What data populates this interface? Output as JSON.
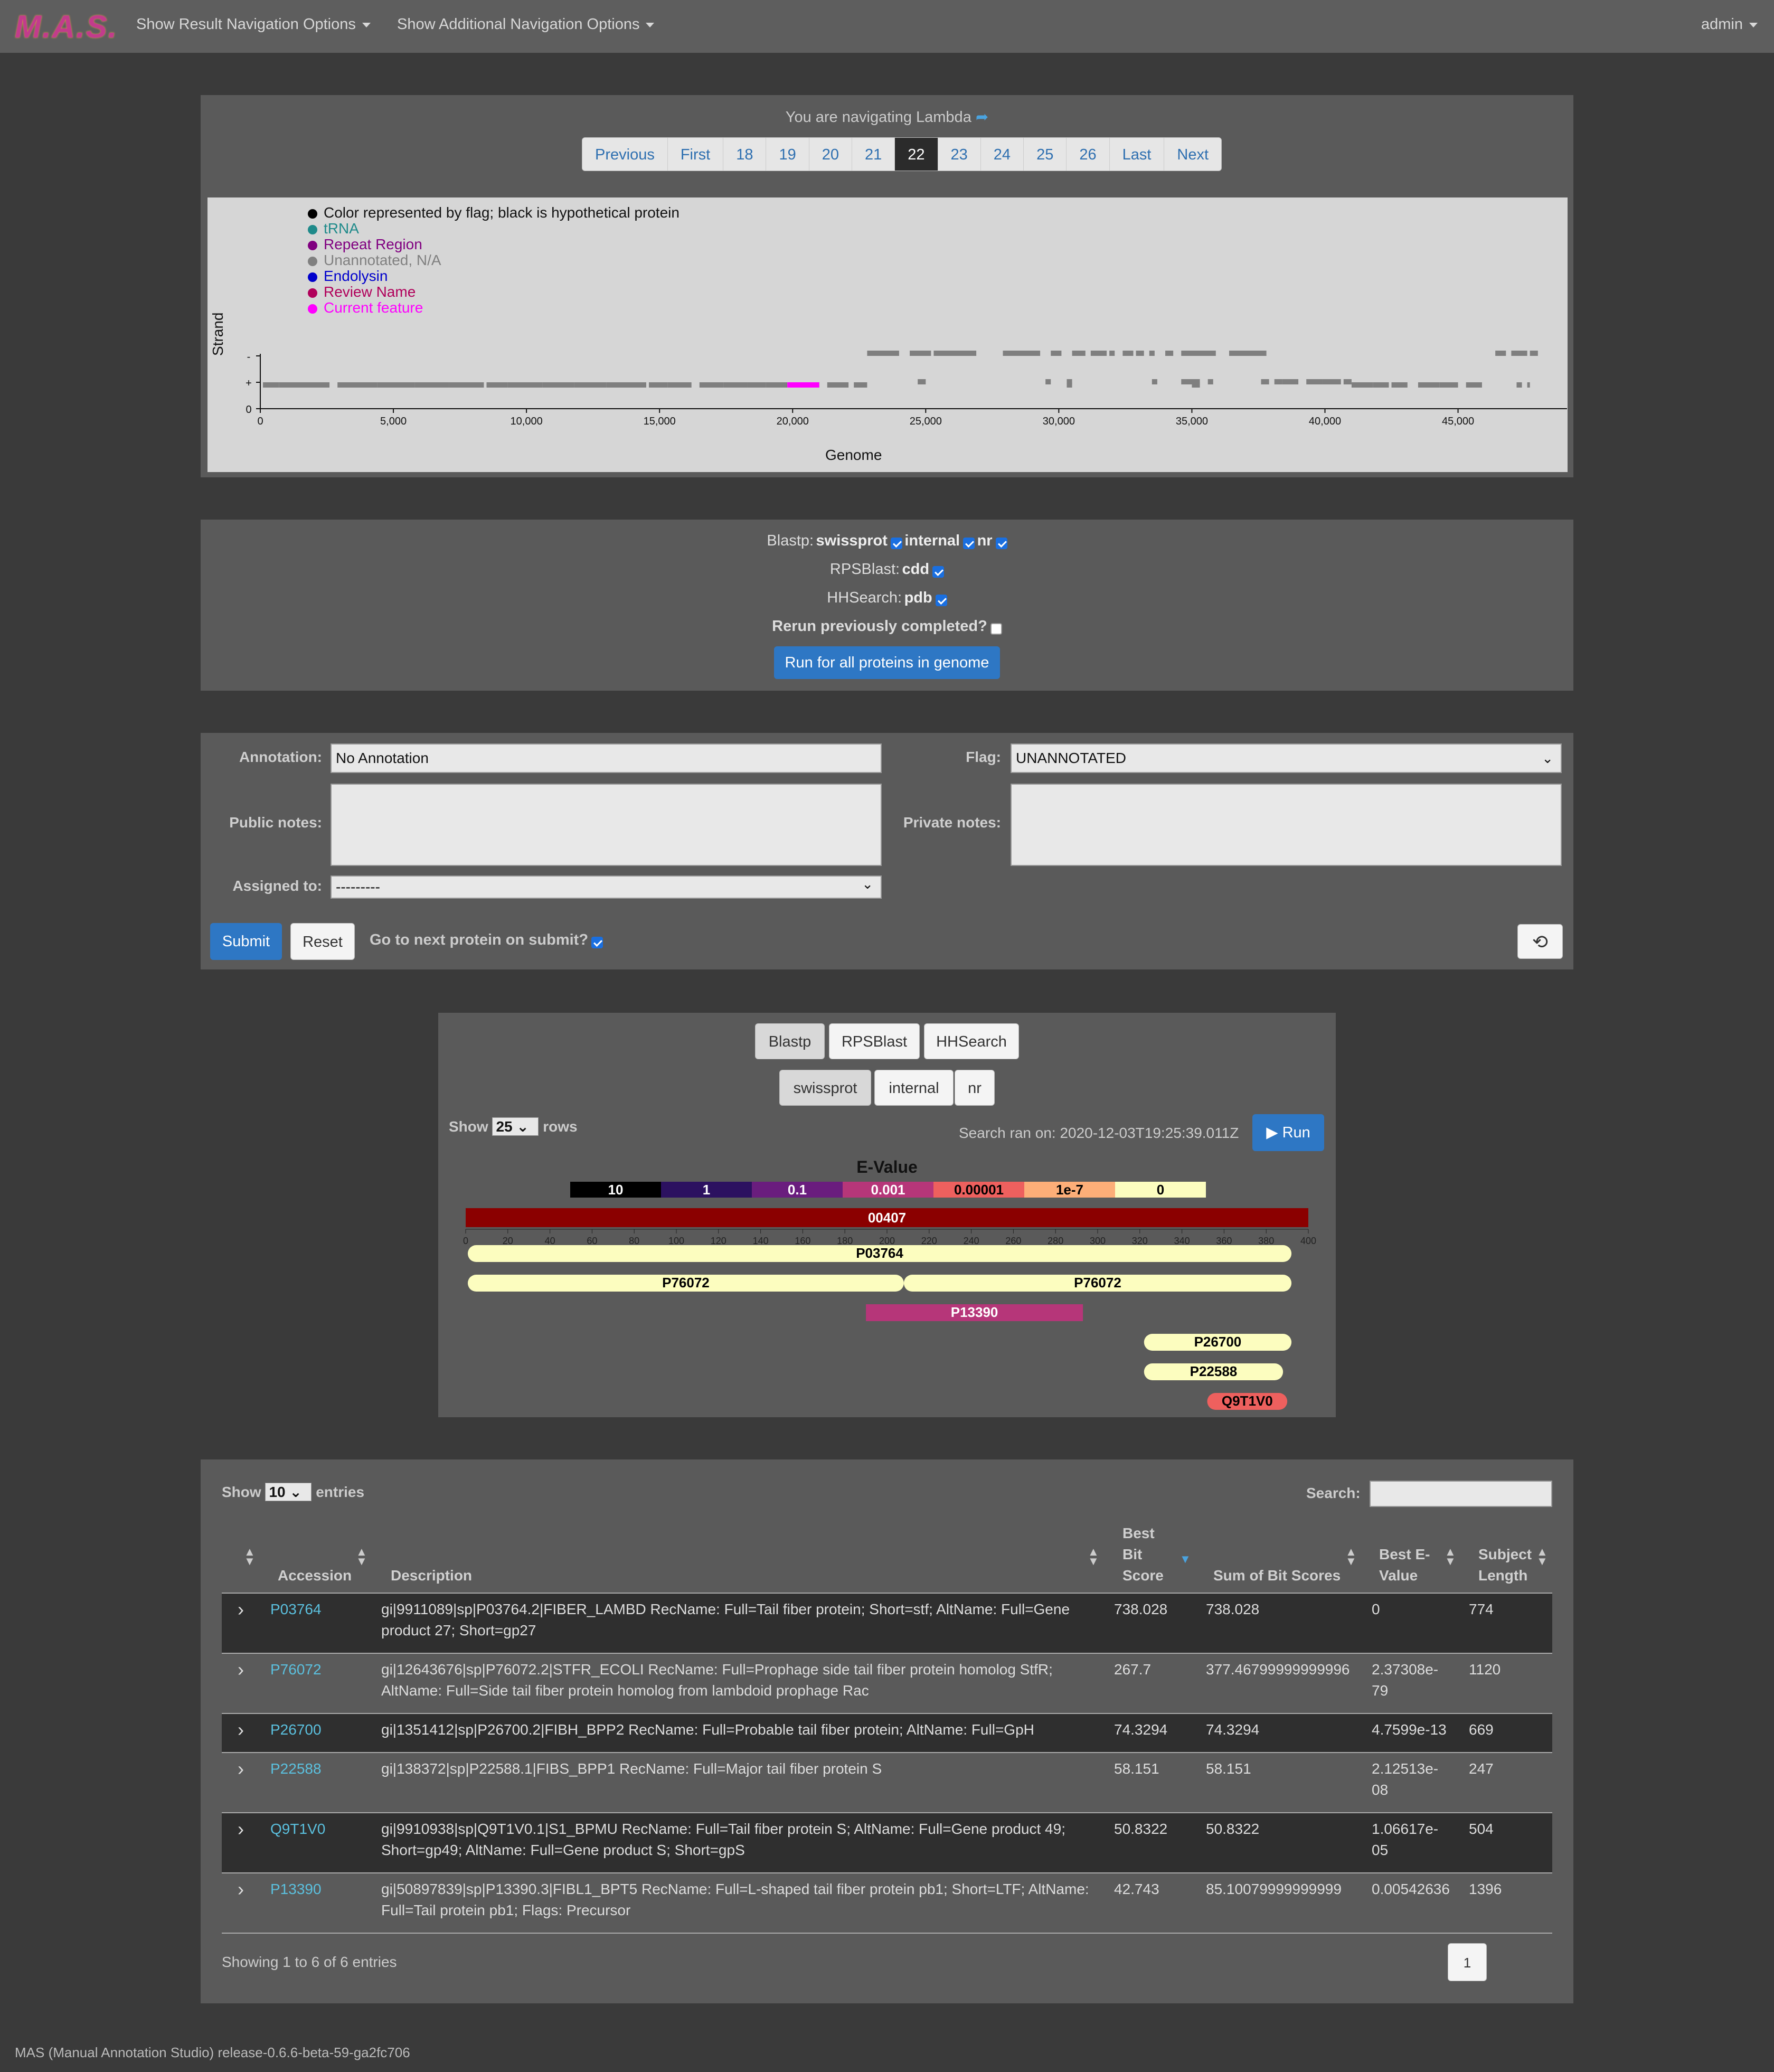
{
  "nav": {
    "logo": "M.A.S.",
    "menu1": "Show Result Navigation Options",
    "menu2": "Show Additional Navigation Options",
    "user": "admin"
  },
  "genome_panel": {
    "navigating_text": "You are navigating Lambda",
    "pages": [
      "Previous",
      "First",
      "18",
      "19",
      "20",
      "21",
      "22",
      "23",
      "24",
      "25",
      "26",
      "Last",
      "Next"
    ],
    "active_page": "22",
    "legend": [
      {
        "label": "Color represented by flag; black is hypothetical protein",
        "color": "#000000"
      },
      {
        "label": "tRNA",
        "color": "#1f8a8a"
      },
      {
        "label": "Repeat Region",
        "color": "#800080"
      },
      {
        "label": "Unannotated, N/A",
        "color": "#808080"
      },
      {
        "label": "Endolysin",
        "color": "#0000cc"
      },
      {
        "label": "Review Name",
        "color": "#b0005a"
      },
      {
        "label": "Current feature",
        "color": "#ff00ff"
      }
    ],
    "y_axis_label": "Strand",
    "y_ticks": [
      "-",
      "+",
      "0"
    ],
    "x_axis_label": "Genome",
    "x_ticks": [
      "0",
      "5,000",
      "10,000",
      "15,000",
      "20,000",
      "25,000",
      "30,000",
      "35,000",
      "40,000",
      "45,000"
    ]
  },
  "blast_panel": {
    "blastp_label": "Blastp:",
    "swissprot": "swissprot",
    "internal": "internal",
    "nr": "nr",
    "rps_label": "RPSBlast:",
    "cdd": "cdd",
    "hh_label": "HHSearch:",
    "pdb": "pdb",
    "rerun_label": "Rerun previously completed?",
    "run_all_button": "Run for all proteins in genome"
  },
  "form": {
    "annotation_label": "Annotation:",
    "annotation_value": "No Annotation",
    "flag_label": "Flag:",
    "flag_value": "UNANNOTATED",
    "public_notes_label": "Public notes:",
    "private_notes_label": "Private notes:",
    "assigned_label": "Assigned to:",
    "assigned_value": "---------",
    "submit": "Submit",
    "reset": "Reset",
    "next_on_submit": "Go to next protein on submit?"
  },
  "results": {
    "tabs": [
      "Blastp",
      "RPSBlast",
      "HHSearch"
    ],
    "db_tabs": [
      "swissprot",
      "internal",
      "nr"
    ],
    "show_label": "Show",
    "rows_value": "25",
    "rows_label": "rows",
    "search_ran": "Search ran on: 2020-12-03T19:25:39.011Z",
    "run_button": "Run",
    "evalue_title": "E-Value",
    "evalue_scale": [
      {
        "label": "10",
        "color": "#000000",
        "text": "#ffffff"
      },
      {
        "label": "1",
        "color": "#2c1160",
        "text": "#ffffff"
      },
      {
        "label": "0.1",
        "color": "#6a1d7e",
        "text": "#ffffff"
      },
      {
        "label": "0.001",
        "color": "#b63679",
        "text": "#ffffff"
      },
      {
        "label": "0.00001",
        "color": "#ee605e",
        "text": "#000000"
      },
      {
        "label": "1e-7",
        "color": "#fdae78",
        "text": "#000000"
      },
      {
        "label": "0",
        "color": "#fcfdbf",
        "text": "#000000"
      }
    ],
    "query_label": "00407",
    "ruler_ticks": [
      "0",
      "20",
      "40",
      "60",
      "80",
      "100",
      "120",
      "140",
      "160",
      "180",
      "200",
      "220",
      "240",
      "260",
      "280",
      "300",
      "320",
      "340",
      "360",
      "380",
      "400"
    ],
    "hits": [
      {
        "label": "P03764",
        "color": "#fcfdbf",
        "text": "#000"
      },
      {
        "label": "P76072",
        "color": "#fcfdbf",
        "text": "#000"
      },
      {
        "label": "P76072",
        "color": "#fcfdbf",
        "text": "#000"
      },
      {
        "label": "P13390",
        "color": "#b63679",
        "text": "#fff"
      },
      {
        "label": "P26700",
        "color": "#fcfdbf",
        "text": "#000"
      },
      {
        "label": "P22588",
        "color": "#fcfdbf",
        "text": "#000"
      },
      {
        "label": "Q9T1V0",
        "color": "#ee605e",
        "text": "#000"
      }
    ]
  },
  "table": {
    "show_label": "Show",
    "entries_value": "10",
    "entries_label": "entries",
    "search_label": "Search:",
    "headers": {
      "accession": "Accession",
      "description": "Description",
      "best_bit_1": "Best",
      "best_bit_2": "Bit",
      "best_bit_3": "Score",
      "sum_bits": "Sum of Bit Scores",
      "best_e_1": "Best E-",
      "best_e_2": "Value",
      "subj_1": "Subject",
      "subj_2": "Length"
    },
    "rows": [
      {
        "acc": "P03764",
        "d1": "gi|9911089|sp|P03764.2|FIBER_LAMBD RecName: Full=Tail fiber protein; Short=stf; AltName: Full=Gene",
        "d2": "product 27; Short=gp27",
        "bit": "738.028",
        "sum": "738.028",
        "e1": "0",
        "e2": "",
        "len": "774"
      },
      {
        "acc": "P76072",
        "d1": "gi|12643676|sp|P76072.2|STFR_ECOLI RecName: Full=Prophage side tail fiber protein homolog StfR;",
        "d2": "AltName: Full=Side tail fiber protein homolog from lambdoid prophage Rac",
        "bit": "267.7",
        "sum": "377.46799999999996",
        "e1": "2.37308e-",
        "e2": "79",
        "len": "1120"
      },
      {
        "acc": "P26700",
        "d1": "gi|1351412|sp|P26700.2|FIBH_BPP2 RecName: Full=Probable tail fiber protein; AltName: Full=GpH",
        "d2": "",
        "bit": "74.3294",
        "sum": "74.3294",
        "e1": "4.7599e-13",
        "e2": "",
        "len": "669"
      },
      {
        "acc": "P22588",
        "d1": "gi|138372|sp|P22588.1|FIBS_BPP1 RecName: Full=Major tail fiber protein S",
        "d2": "",
        "bit": "58.151",
        "sum": "58.151",
        "e1": "2.12513e-",
        "e2": "08",
        "len": "247"
      },
      {
        "acc": "Q9T1V0",
        "d1": "gi|9910938|sp|Q9T1V0.1|S1_BPMU RecName: Full=Tail fiber protein S; AltName: Full=Gene product 49;",
        "d2": "Short=gp49; AltName: Full=Gene product S; Short=gpS",
        "bit": "50.8322",
        "sum": "50.8322",
        "e1": "1.06617e-",
        "e2": "05",
        "len": "504"
      },
      {
        "acc": "P13390",
        "d1": "gi|50897839|sp|P13390.3|FIBL1_BPT5 RecName: Full=L-shaped tail fiber protein pb1; Short=LTF; AltName:",
        "d2": "Full=Tail protein pb1; Flags: Precursor",
        "bit": "42.743",
        "sum": "85.10079999999999",
        "e1": "0.00542636",
        "e2": "",
        "len": "1396"
      }
    ],
    "showing": "Showing 1 to 6 of 6 entries",
    "page": "1"
  },
  "footer": "MAS (Manual Annotation Studio) release-0.6.6-beta-59-ga2fc706"
}
